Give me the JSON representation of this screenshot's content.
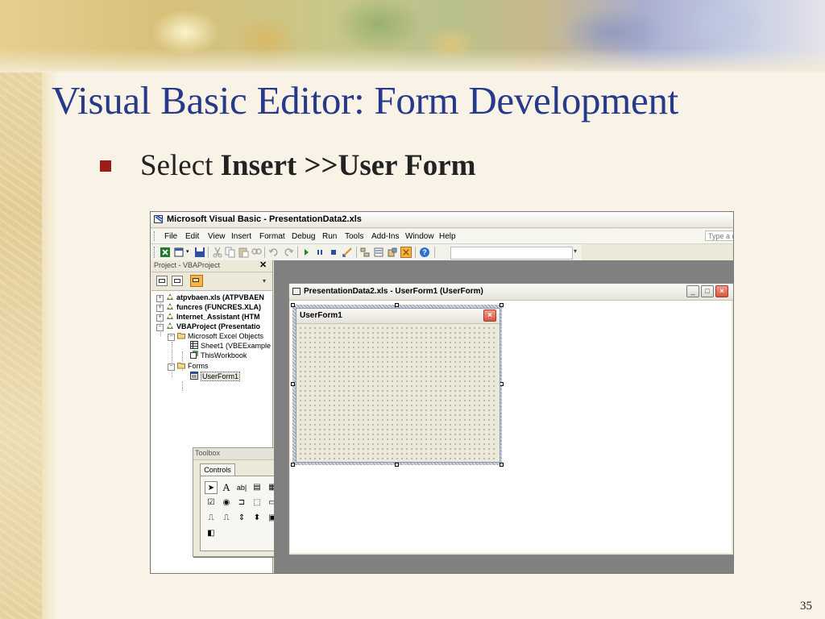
{
  "slide": {
    "title": "Visual Basic Editor: Form Development",
    "bullet_prefix": "Select ",
    "bullet_bold": "Insert >>User Form",
    "page_number": "35"
  },
  "editor": {
    "window_title": "Microsoft Visual Basic - PresentationData2.xls",
    "menu": [
      "File",
      "Edit",
      "View",
      "Insert",
      "Format",
      "Debug",
      "Run",
      "Tools",
      "Add-Ins",
      "Window",
      "Help"
    ],
    "help_placeholder": "Type a q",
    "project_explorer": {
      "title": "Project - VBAProject",
      "close": "✕",
      "items": [
        {
          "label": "atpvbaen.xls (ATPVBAEN"
        },
        {
          "label": "funcres (FUNCRES.XLA)"
        },
        {
          "label": "Internet_Assistant (HTM"
        },
        {
          "label": "VBAProject (Presentatio"
        },
        {
          "label": "Microsoft Excel Objects"
        },
        {
          "label": "Sheet1 (VBEExample"
        },
        {
          "label": "ThisWorkbook"
        },
        {
          "label": "Forms"
        },
        {
          "label": "UserForm1"
        }
      ]
    },
    "toolbox": {
      "title": "Toolbox",
      "tab": "Controls",
      "tools": [
        "pointer",
        "label",
        "textbox",
        "combobox",
        "listbox",
        "checkbox",
        "optionbutton",
        "togglebutton",
        "frame",
        "commandbutton",
        "tabstrip",
        "multipage",
        "scrollbar",
        "spinbutton",
        "image",
        "refedit"
      ]
    },
    "child_window_title": "PresentationData2.xls - UserForm1 (UserForm)",
    "userform_title": "UserForm1"
  },
  "colors": {
    "title": "#27398a",
    "bullet": "#9c1b1b"
  }
}
